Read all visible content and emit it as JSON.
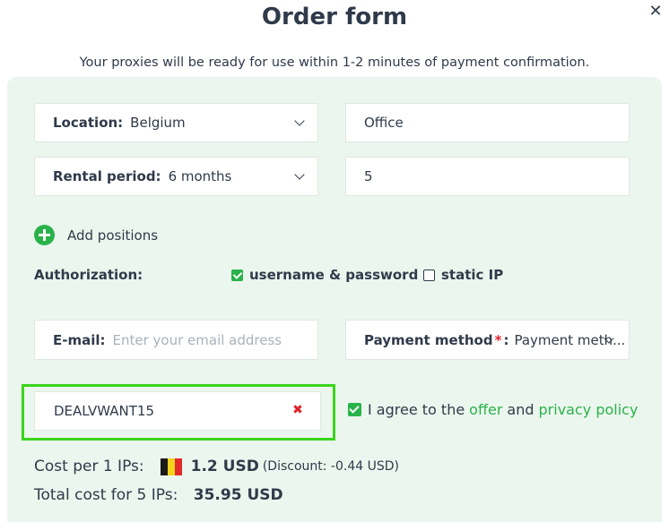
{
  "title": "Order form",
  "subtitle": "Your proxies will be ready for use within 1-2 minutes of payment confirmation.",
  "location": {
    "label": "Location:",
    "value": "Belgium"
  },
  "proxy_name": {
    "value": "Office"
  },
  "rental_period": {
    "label": "Rental period:",
    "value": "6 months"
  },
  "quantity": {
    "value": "5"
  },
  "add_positions_label": "Add positions",
  "authorization": {
    "label": "Authorization:",
    "options": [
      {
        "label": "username & password",
        "checked": true
      },
      {
        "label": "static IP",
        "checked": false
      }
    ]
  },
  "email": {
    "label": "E-mail:",
    "placeholder": "Enter your email address"
  },
  "payment": {
    "label": "Payment method",
    "required_mark": "*",
    "colon": ":",
    "value": "Payment meth..."
  },
  "promo_code": {
    "value": "DEALVWANT15"
  },
  "agree": {
    "prefix": "I agree to the",
    "offer": "offer",
    "and": "and",
    "privacy": "privacy policy",
    "checked": true
  },
  "cost_per_ip": {
    "label": "Cost per 1 IPs:",
    "price": "1.2 USD",
    "discount": "(Discount: -0.44 USD)"
  },
  "total_cost": {
    "label": "Total cost for 5 IPs:",
    "price": "35.95 USD"
  },
  "colors": {
    "accent": "#2ab24a",
    "panel": "#ebf6ee",
    "highlight": "#3ad51c",
    "error": "#e0202a",
    "text": "#2f3a4a"
  },
  "icons": {
    "close": "close-icon",
    "add": "plus-circle-icon",
    "chevron": "chevron-down-icon",
    "flag": "belgium-flag-icon",
    "clear": "clear-x-icon"
  }
}
